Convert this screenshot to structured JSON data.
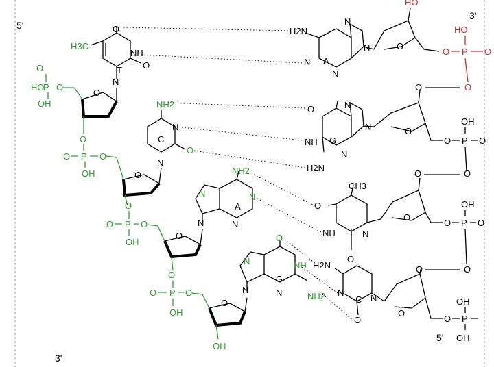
{
  "colors": {
    "strand_left": "#2ca02c",
    "strand_right_top": "#d62728",
    "bonds": "#000000"
  },
  "ends": {
    "left_top": "5'",
    "left_bottom": "3'",
    "right_top": "3'",
    "right_bottom": "5'"
  },
  "left_strand": {
    "bases": [
      {
        "letter": "T",
        "atoms": [
          "O",
          "NH",
          "O",
          "N",
          "H3C"
        ]
      },
      {
        "letter": "C",
        "atoms": [
          "NH2",
          "N",
          "N",
          "O"
        ]
      },
      {
        "letter": "A",
        "atoms": [
          "NH2",
          "N",
          "N",
          "N",
          "N"
        ]
      },
      {
        "letter": "G",
        "atoms": [
          "O",
          "NH",
          "NH2",
          "N",
          "N",
          "N"
        ]
      }
    ],
    "phosphates": [
      {
        "atoms": [
          "HO",
          "P",
          "O",
          "O",
          "OH"
        ]
      },
      {
        "atoms": [
          "O",
          "O",
          "P",
          "O",
          "OH"
        ]
      },
      {
        "atoms": [
          "O",
          "O",
          "P",
          "O",
          "OH"
        ]
      },
      {
        "atoms": [
          "O",
          "O",
          "P",
          "O",
          "OH"
        ]
      }
    ],
    "sugar_atoms": [
      "O",
      "O",
      "O",
      "O"
    ],
    "terminal_oh": "OH"
  },
  "right_strand": {
    "bases": [
      {
        "letter": "A",
        "atoms": [
          "H2N",
          "N",
          "N",
          "N",
          "N"
        ]
      },
      {
        "letter": "G",
        "atoms": [
          "O",
          "N",
          "NH",
          "H2N",
          "N",
          "N"
        ]
      },
      {
        "letter": "T",
        "atoms": [
          "CH3",
          "O",
          "NH",
          "O",
          "N"
        ]
      },
      {
        "letter": "C",
        "atoms": [
          "H2N",
          "N",
          "O",
          "N"
        ]
      }
    ],
    "phosphates": [
      {
        "atoms": [
          "HO",
          "P",
          "O",
          "O"
        ]
      },
      {
        "atoms": [
          "OH",
          "P",
          "O",
          "O"
        ]
      },
      {
        "atoms": [
          "OH",
          "P",
          "O",
          "O"
        ]
      },
      {
        "atoms": [
          "OH",
          "P",
          "O",
          "OH"
        ]
      }
    ],
    "sugar_atoms": [
      "O",
      "O",
      "O",
      "O"
    ],
    "bridge_o": [
      "O",
      "O",
      "O"
    ],
    "terminal_oh": "HO"
  }
}
